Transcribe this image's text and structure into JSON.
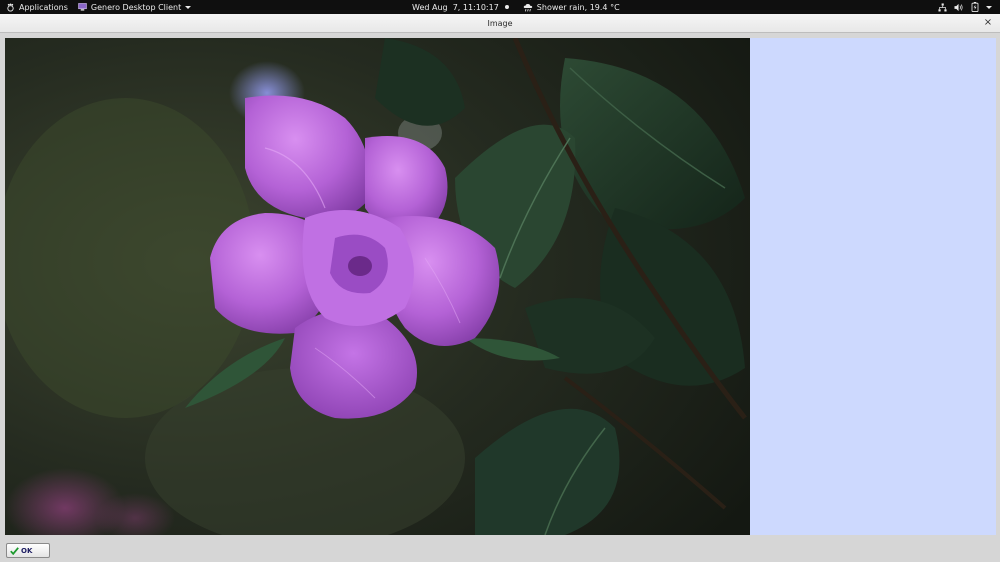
{
  "topbar": {
    "applications_label": "Applications",
    "app_menu_label": "Genero Desktop Client",
    "datetime": "Wed Aug  7, 11:10:17",
    "weather": "Shower rain, 19.4 °C"
  },
  "window": {
    "title": "Image",
    "close_label": "×"
  },
  "footer": {
    "ok_label": "OK"
  },
  "colors": {
    "side_panel": "#cdd9fe",
    "flower": "#b060d0",
    "topbar": "#0f0f0f"
  }
}
